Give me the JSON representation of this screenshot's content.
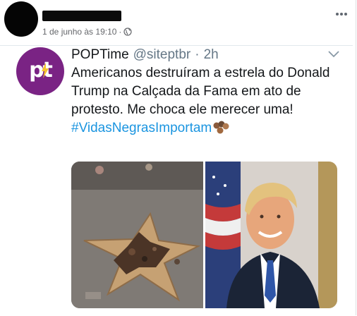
{
  "facebook_post": {
    "author_name": "████████████",
    "timestamp": "1 de junho às 19:10",
    "separator": "·",
    "privacy_icon": "globe-icon",
    "more_icon": "more-options-icon"
  },
  "tweet": {
    "avatar_logo": "pt",
    "display_name": "POPTime",
    "handle": "@siteptbr",
    "dot": "·",
    "time": "2h",
    "text": "Americanos destruíram a estrela do Donald Trump na Calçada da Fama em ato de protesto. Me choca ele merecer uma!",
    "hashtag": "#VidasNegrasImportam",
    "emoji": "raised-fist-emoji",
    "images": [
      "damaged-walk-of-fame-star-photo",
      "donald-trump-portrait-photo"
    ]
  },
  "colors": {
    "brand_purple": "#7a2384",
    "link_blue": "#1b95e0",
    "muted_gray": "#657786",
    "fb_gray": "#65676b"
  }
}
